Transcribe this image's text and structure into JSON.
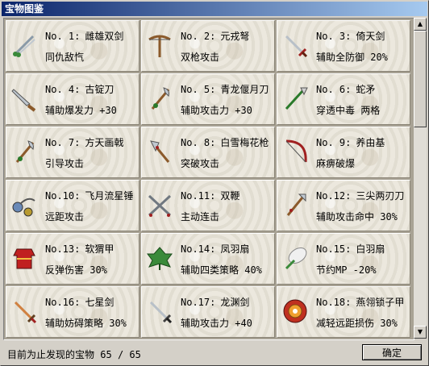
{
  "window": {
    "title": "宝物图鉴"
  },
  "items": [
    {
      "no": "No. 1:",
      "name": "雌雄双剑",
      "effect": "同仇敌忾",
      "icon": "twin-swords-icon"
    },
    {
      "no": "No. 2:",
      "name": "元戎弩",
      "effect": "双枪攻击",
      "icon": "crossbow-icon"
    },
    {
      "no": "No. 3:",
      "name": "倚天剑",
      "effect": "辅助全防御 20%",
      "icon": "sword-icon"
    },
    {
      "no": "No. 4:",
      "name": "古锭刀",
      "effect": "辅助爆发力 +30",
      "icon": "blade-icon"
    },
    {
      "no": "No. 5:",
      "name": "青龙偃月刀",
      "effect": "辅助攻击力 +30",
      "icon": "halberd-icon"
    },
    {
      "no": "No. 6:",
      "name": "蛇矛",
      "effect": "穿透中毒 两格",
      "icon": "spear-icon"
    },
    {
      "no": "No. 7:",
      "name": "方天画戟",
      "effect": "引导攻击",
      "icon": "halberd-icon"
    },
    {
      "no": "No. 8:",
      "name": "白雪梅花枪",
      "effect": "突破攻击",
      "icon": "axe-icon"
    },
    {
      "no": "No. 9:",
      "name": "养由基",
      "effect": "麻痹破爆",
      "icon": "bow-icon"
    },
    {
      "no": "No.10:",
      "name": "飞月流星锤",
      "effect": "远距攻击",
      "icon": "meteor-hammer-icon"
    },
    {
      "no": "No.11:",
      "name": "双鞭",
      "effect": "主动连击",
      "icon": "twin-whips-icon"
    },
    {
      "no": "No.12:",
      "name": "三尖两刃刀",
      "effect": "辅助攻击命中 30%",
      "icon": "trident-icon"
    },
    {
      "no": "No.13:",
      "name": "软猬甲",
      "effect": "反弹伤害 30%",
      "icon": "armor-icon"
    },
    {
      "no": "No.14:",
      "name": "凤羽扇",
      "effect": "辅助四类策略 40%",
      "icon": "leaf-fan-icon"
    },
    {
      "no": "No.15:",
      "name": "白羽扇",
      "effect": "节约MP -20%",
      "icon": "feather-fan-icon"
    },
    {
      "no": "No.16:",
      "name": "七星剑",
      "effect": "辅助妨碍策略 30%",
      "icon": "seven-star-sword-icon"
    },
    {
      "no": "No.17:",
      "name": "龙渊剑",
      "effect": "辅助攻击力 +40",
      "icon": "long-sword-icon"
    },
    {
      "no": "No.18:",
      "name": "燕翎锁子甲",
      "effect": "减轻远距损伤 30%",
      "icon": "chainmail-icon"
    }
  ],
  "status": {
    "label": "目前为止发现的宝物",
    "found": "65",
    "sep": "/",
    "total": "65"
  },
  "buttons": {
    "ok": "确定"
  }
}
